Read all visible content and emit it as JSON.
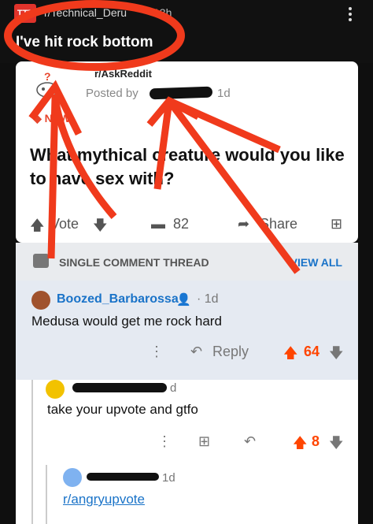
{
  "header": {
    "sub_icon_text": "TTT",
    "sub_name": "r/Technical_Deru",
    "time": "13h",
    "title": "I've hit rock bottom"
  },
  "crosspost": {
    "subreddit": "r/AskReddit",
    "posted_by_prefix": "Posted by",
    "time": "1d",
    "badge": "NEW",
    "title": "What mythical creature would you like to have sex with?",
    "vote_label": "Vote",
    "comments": "82",
    "share_label": "Share"
  },
  "thread_bar": {
    "label": "SINGLE COMMENT THREAD",
    "view_all": "VIEW ALL"
  },
  "comments": [
    {
      "user": "Boozed_Barbarossa",
      "time": "· 1d",
      "body": "Medusa would get me rock hard",
      "reply_label": "Reply",
      "score": "64"
    },
    {
      "user_suffix": "d",
      "body": "take your upvote and gtfo",
      "score": "8"
    },
    {
      "time": "1d",
      "body": "r/angryupvote"
    }
  ],
  "colors": {
    "upvote": "#ff4500",
    "link": "#1a73c8",
    "annotation": "#f03a1c"
  }
}
